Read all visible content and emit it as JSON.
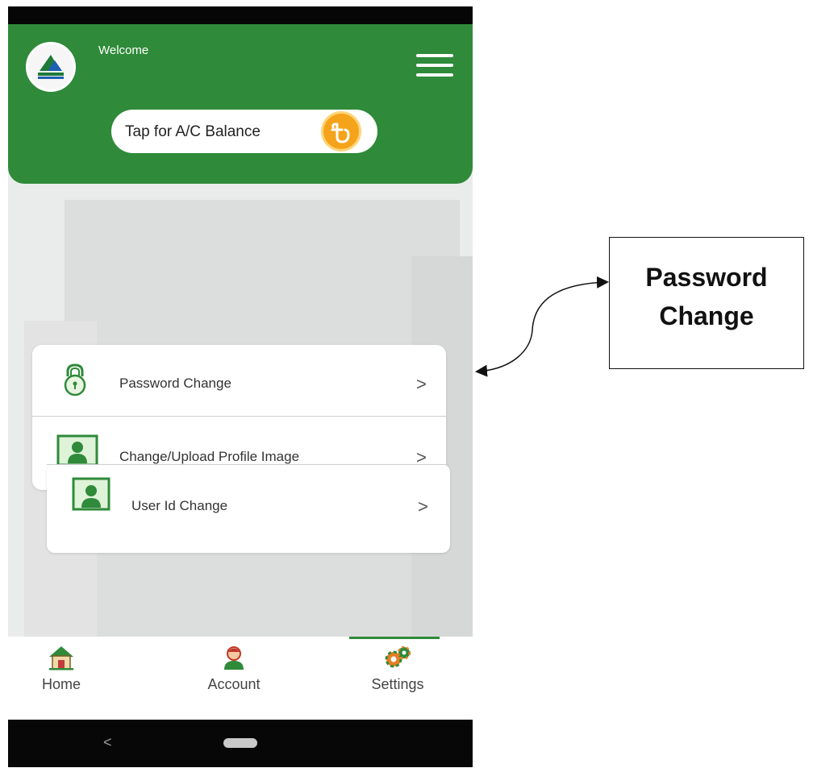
{
  "header": {
    "welcome": "Welcome",
    "balance_button": "Tap for A/C Balance"
  },
  "menu": {
    "items": [
      {
        "label": "Password Change",
        "icon": "lock-icon"
      },
      {
        "label": "Change/Upload Profile Image",
        "icon": "user-icon"
      },
      {
        "label": "User Id Change",
        "icon": "user-icon"
      }
    ],
    "chevron": ">"
  },
  "nav": {
    "items": [
      {
        "label": "Home",
        "icon": "home-icon"
      },
      {
        "label": "Account",
        "icon": "account-icon"
      },
      {
        "label": "Settings",
        "icon": "settings-icon"
      }
    ],
    "active": "Settings"
  },
  "system_nav": {
    "back": "<"
  },
  "annotation": {
    "line1": "Password",
    "line2": "Change"
  },
  "colors": {
    "brand_green": "#2f8a3a",
    "coin": "#f5a31b"
  }
}
